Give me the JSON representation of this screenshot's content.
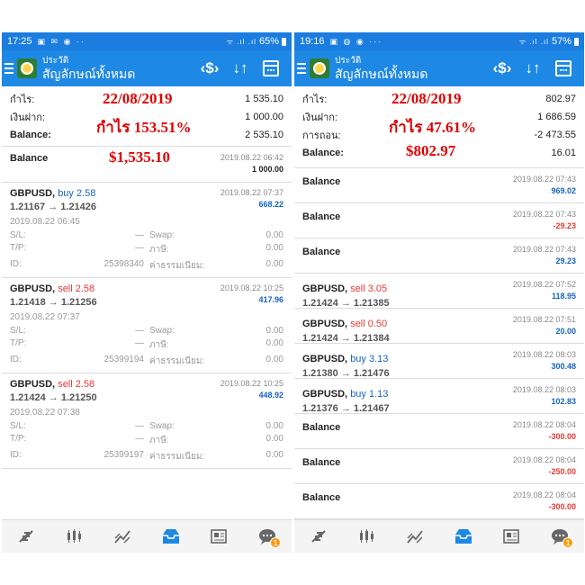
{
  "left": {
    "status": {
      "time": "17:25",
      "notif_icons": "▣ ✉ ◉ ··",
      "signal": "ᯤ .ıl .ıl",
      "battery": "65%"
    },
    "appbar": {
      "subtitle": "ประวัติ",
      "title": "สัญลักษณ์ทั้งหมด",
      "action_symbol": "‹$›",
      "action_sort": "↓↑"
    },
    "summary": [
      {
        "key": "กำไร:",
        "value": "1 535.10"
      },
      {
        "key": "เงินฝาก:",
        "value": "1 000.00"
      },
      {
        "key": "Balance:",
        "value": "2 535.10"
      }
    ],
    "overlay": {
      "date": "22/08/2019",
      "profit": "กำไร 153.51%",
      "amount": "$1,535.10"
    },
    "balance_row": {
      "label": "Balance",
      "time": "2019.08.22 06:42",
      "amount": "1 000.00"
    },
    "deals": [
      {
        "symbol": "GBPUSD,",
        "side": "buy 2.58",
        "prices": "1.21167 → 1.21426",
        "time": "2019.08.22 07:37",
        "profit": "668.22",
        "open": "2019.08.22 06:45",
        "sl_label": "S/L:",
        "sl": "—",
        "swap_label": "Swap:",
        "swap": "0.00",
        "tp_label": "T/P:",
        "tp": "—",
        "tax_label": "ภาษี:",
        "tax": "0.00",
        "id_label": "ID:",
        "id": "25398340",
        "fee_label": "ค่าธรรมเนียม:",
        "fee": "0.00"
      },
      {
        "symbol": "GBPUSD,",
        "side": "sell 2.58",
        "prices": "1.21418 → 1.21256",
        "time": "2019.08.22 10:25",
        "profit": "417.96",
        "open": "2019.08.22 07:37",
        "sl_label": "S/L:",
        "sl": "—",
        "swap_label": "Swap:",
        "swap": "0.00",
        "tp_label": "T/P:",
        "tp": "—",
        "tax_label": "ภาษี:",
        "tax": "0.00",
        "id_label": "ID:",
        "id": "25399194",
        "fee_label": "ค่าธรรมเนียม:",
        "fee": "0.00"
      },
      {
        "symbol": "GBPUSD,",
        "side": "sell 2.58",
        "prices": "1.21424 → 1.21250",
        "time": "2019.08.22 10:25",
        "profit": "448.92",
        "open": "2019.08.22 07:38",
        "sl_label": "S/L:",
        "sl": "—",
        "swap_label": "Swap:",
        "swap": "0.00",
        "tp_label": "T/P:",
        "tp": "—",
        "tax_label": "ภาษี:",
        "tax": "0.00",
        "id_label": "ID:",
        "id": "25399197",
        "fee_label": "ค่าธรรมเนียม:",
        "fee": "0.00"
      }
    ],
    "nav_badge": "1"
  },
  "right": {
    "status": {
      "time": "19:16",
      "notif_icons": "▣ ◍ ◉ ···",
      "signal": "ᯤ .ıl .ıl",
      "battery": "57%"
    },
    "appbar": {
      "subtitle": "ประวัติ",
      "title": "สัญลักษณ์ทั้งหมด",
      "action_symbol": "‹$›",
      "action_sort": "↓↑"
    },
    "summary": [
      {
        "key": "กำไร:",
        "value": "802.97"
      },
      {
        "key": "เงินฝาก:",
        "value": "1 686.59"
      },
      {
        "key": "การถอน:",
        "value": "-2 473.55"
      },
      {
        "key": "Balance:",
        "value": "16.01"
      }
    ],
    "overlay": {
      "date": "22/08/2019",
      "profit": "กำไร 47.61%",
      "amount": "$802.97"
    },
    "rows": [
      {
        "kind": "balance",
        "label": "Balance",
        "time": "2019.08.22 07:43",
        "amount": "969.02",
        "neg": false
      },
      {
        "kind": "balance",
        "label": "Balance",
        "time": "2019.08.22 07:43",
        "amount": "-29.23",
        "neg": true
      },
      {
        "kind": "balance",
        "label": "Balance",
        "time": "2019.08.22 07:43",
        "amount": "29.23",
        "neg": false
      },
      {
        "kind": "deal",
        "symbol": "GBPUSD,",
        "side": "sell 3.05",
        "sidetype": "sell",
        "prices": "1.21424 → 1.21385",
        "time": "2019.08.22 07:52",
        "amount": "118.95"
      },
      {
        "kind": "deal",
        "symbol": "GBPUSD,",
        "side": "sell 0.50",
        "sidetype": "sell",
        "prices": "1.21424 → 1.21384",
        "time": "2019.08.22 07:51",
        "amount": "20.00"
      },
      {
        "kind": "deal",
        "symbol": "GBPUSD,",
        "side": "buy 3.13",
        "sidetype": "buy",
        "prices": "1.21380 → 1.21476",
        "time": "2019.08.22 08:03",
        "amount": "300.48"
      },
      {
        "kind": "deal",
        "symbol": "GBPUSD,",
        "side": "buy 1.13",
        "sidetype": "buy",
        "prices": "1.21376 → 1.21467",
        "time": "2019.08.22 08:03",
        "amount": "102.83"
      },
      {
        "kind": "balance",
        "label": "Balance",
        "time": "2019.08.22 08:04",
        "amount": "-300.00",
        "neg": true
      },
      {
        "kind": "balance",
        "label": "Balance",
        "time": "2019.08.22 08:04",
        "amount": "-250.00",
        "neg": true
      },
      {
        "kind": "balance",
        "label": "Balance",
        "time": "2019.08.22 08:04",
        "amount": "-300.00",
        "neg": true
      }
    ],
    "nav_badge": "1"
  },
  "colors": {
    "appbar": "#1e88e5",
    "statusbar": "#1b7de0",
    "buy": "#1565c0",
    "sell": "#e53935",
    "overlay": "#e00000"
  },
  "nav_icons": [
    "quotes-icon",
    "chart-icon",
    "trade-icon",
    "history-icon",
    "news-icon",
    "chat-icon"
  ]
}
